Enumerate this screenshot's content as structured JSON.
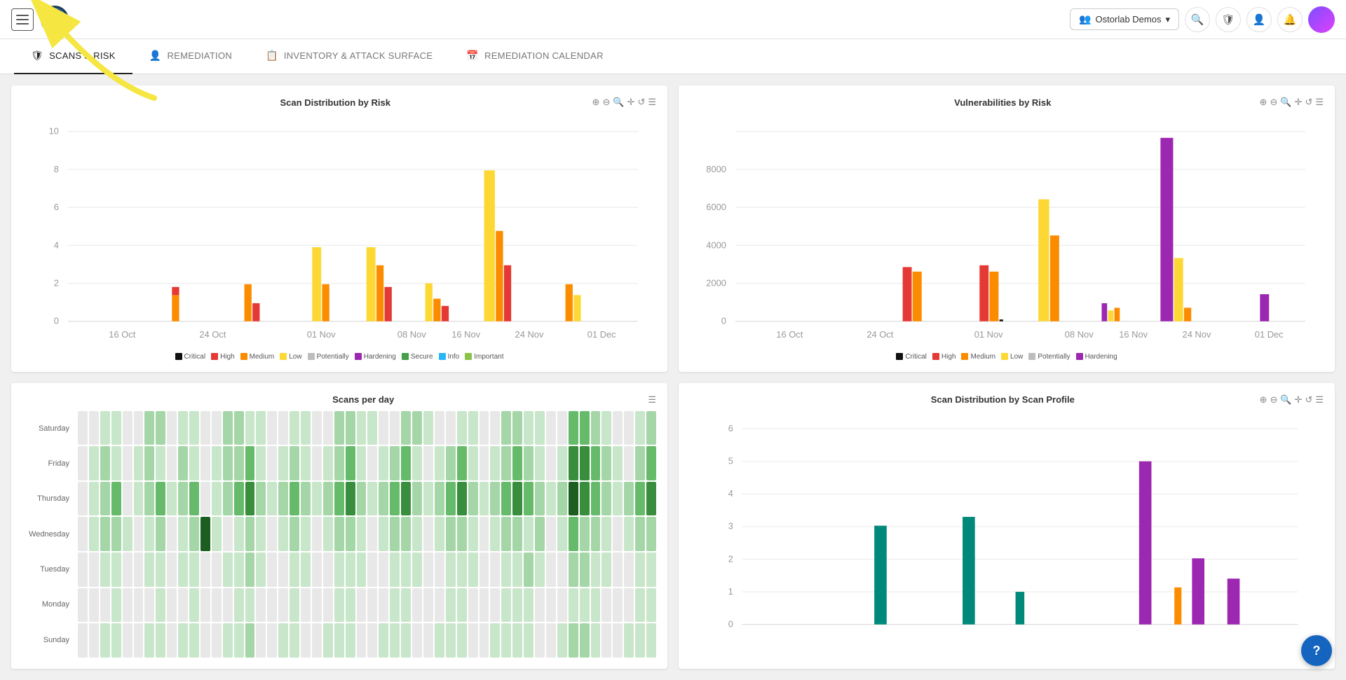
{
  "topnav": {
    "org_name": "Ostorlab Demos",
    "chevron": "▾",
    "search_icon": "🔍",
    "shield_icon": "🛡",
    "user_icon": "👤",
    "bell_icon": "🔔"
  },
  "tabs": [
    {
      "id": "scans-risk",
      "label": "SCANS & RISK",
      "icon": "shield",
      "active": true
    },
    {
      "id": "remediation",
      "label": "REMEDIATION",
      "icon": "person",
      "active": false
    },
    {
      "id": "inventory-attack",
      "label": "INVENTORY & ATTACK SURFACE",
      "icon": "calendar",
      "active": false
    },
    {
      "id": "remediation-calendar",
      "label": "REMEDIATION CALENDAR",
      "icon": "calendar",
      "active": false
    }
  ],
  "charts": {
    "scan_distribution": {
      "title": "Scan Distribution by Risk",
      "ymax": 10,
      "yticks": [
        0,
        2,
        4,
        6,
        8,
        10
      ],
      "xticks": [
        "16 Oct",
        "24 Oct",
        "01 Nov",
        "08 Nov",
        "16 Nov",
        "24 Nov",
        "01 Dec"
      ],
      "legend": [
        {
          "label": "Critical",
          "color": "#111111"
        },
        {
          "label": "High",
          "color": "#e53935"
        },
        {
          "label": "Medium",
          "color": "#fb8c00"
        },
        {
          "label": "Low",
          "color": "#fdd835"
        },
        {
          "label": "Potentially",
          "color": "#bdbdbd"
        },
        {
          "label": "Hardening",
          "color": "#9c27b0"
        },
        {
          "label": "Secure",
          "color": "#43a047"
        },
        {
          "label": "Info",
          "color": "#29b6f6"
        },
        {
          "label": "Important",
          "color": "#8bc34a"
        }
      ]
    },
    "vulnerabilities_by_risk": {
      "title": "Vulnerabilities by Risk",
      "ymax": 8000,
      "yticks": [
        0,
        2000,
        4000,
        6000,
        8000
      ],
      "xticks": [
        "16 Oct",
        "24 Oct",
        "01 Nov",
        "08 Nov",
        "16 Nov",
        "24 Nov",
        "01 Dec"
      ],
      "legend": [
        {
          "label": "Critical",
          "color": "#111111"
        },
        {
          "label": "High",
          "color": "#e53935"
        },
        {
          "label": "Medium",
          "color": "#fb8c00"
        },
        {
          "label": "Low",
          "color": "#fdd835"
        },
        {
          "label": "Potentially",
          "color": "#bdbdbd"
        },
        {
          "label": "Hardening",
          "color": "#9c27b0"
        }
      ]
    },
    "scans_per_day": {
      "title": "Scans per day",
      "days": [
        "Saturday",
        "Friday",
        "Thursday",
        "Wednesday",
        "Tuesday",
        "Monday",
        "Sunday"
      ]
    },
    "scan_distribution_profile": {
      "title": "Scan Distribution by Scan Profile",
      "ymax": 6,
      "yticks": [
        0,
        1,
        2,
        3,
        4,
        5,
        6
      ]
    }
  },
  "help_button": "?",
  "annotation": {
    "arrow_text": ""
  }
}
